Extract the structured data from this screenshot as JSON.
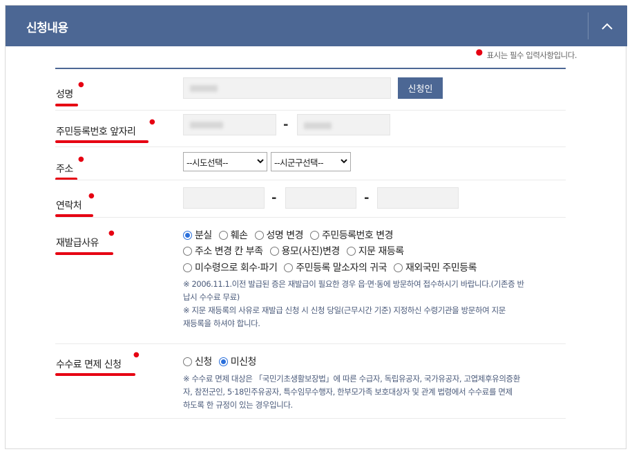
{
  "header": {
    "title": "신청내용",
    "collapse_icon": "chevron-up-icon"
  },
  "required_note": "표시는 필수 입력사항입니다.",
  "fields": {
    "name": {
      "label": "성명",
      "apply_button": "신청인"
    },
    "resident": {
      "label": "주민등록번호 앞자리",
      "separator": "-"
    },
    "address": {
      "label": "주소",
      "sido": "--시도선택--",
      "sigungu": "--시군구선택--"
    },
    "contact": {
      "label": "연락처",
      "separator1": "-",
      "separator2": "-"
    },
    "reason": {
      "label": "재발급사유",
      "options": [
        "분실",
        "훼손",
        "성명 변경",
        "주민등록번호 변경",
        "주소 변경 칸 부족",
        "용모(사진)변경",
        "지문 재등록",
        "미수령으로 회수·파기",
        "주민등록 말소자의 귀국",
        "재외국민 주민등록"
      ],
      "selected": "분실",
      "notice1_line1": "※ 2006.11.1.이전 발급된 증은 재발급이 필요한 경우 읍·면·동에 방문하여 접수하시기 바랍니다.(기존증 반",
      "notice1_line2": "납시 수수료 무료)",
      "notice2_line1": "※ 지문 재등록의 사유로 재발급 신청 시 신청 당일(근무시간 기준) 지정하신 수령기관을 방문하여 지문",
      "notice2_line2": "재등록을 하셔야 합니다."
    },
    "fee": {
      "label": "수수료 면제 신청",
      "options": [
        "신청",
        "미신청"
      ],
      "selected": "미신청",
      "notice_line1": "※ 수수료 면제 대상은 「국민기초생활보장법」에 따른 수급자, 독립유공자, 국가유공자, 고엽제후유의증환",
      "notice_line2": "자, 참전군인, 5·18민주유공자, 특수임무수행자, 한부모가족 보호대상자 및 관계 법령에서 수수료를 면제",
      "notice_line3": "하도록 한 규정이 있는 경우입니다."
    }
  },
  "colors": {
    "header_bg": "#4c6794",
    "required_mark": "#e60012",
    "radio_checked": "#2a6fdb"
  }
}
